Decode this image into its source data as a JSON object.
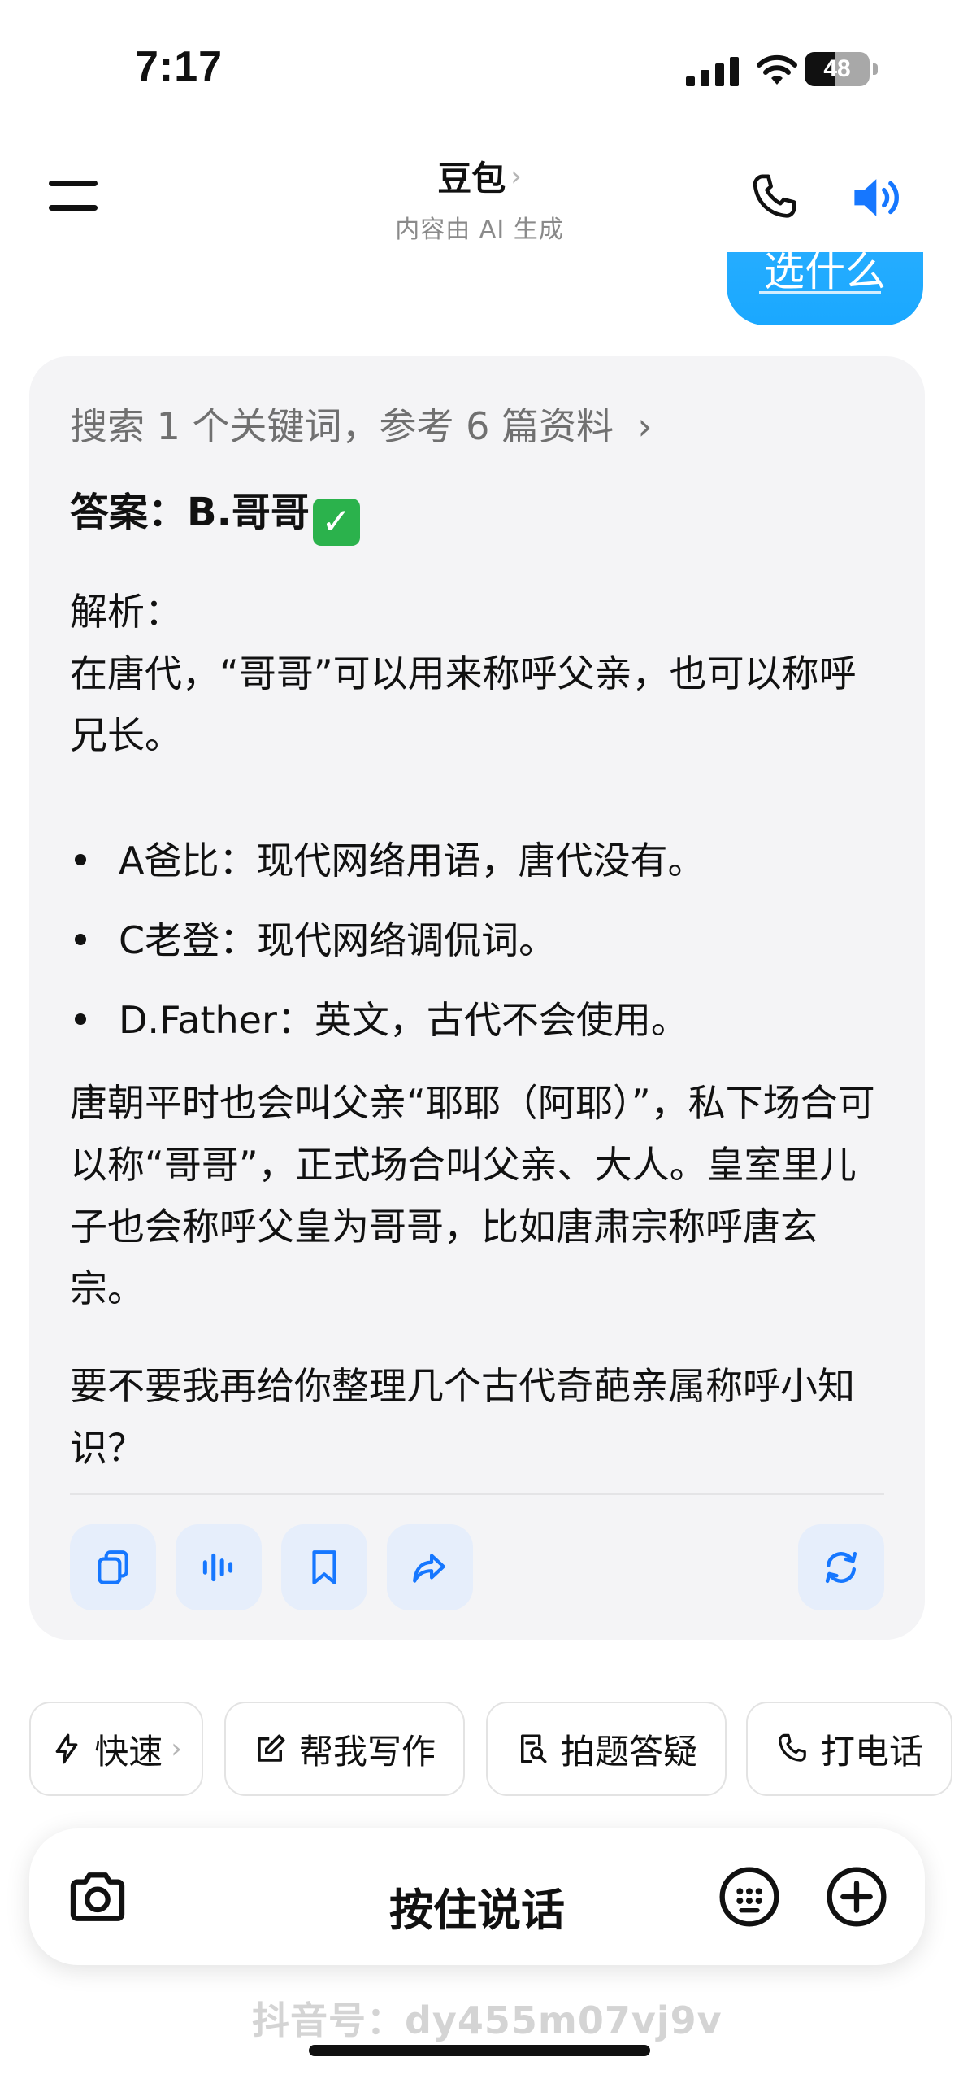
{
  "status_bar": {
    "time": "7:17",
    "battery": "48"
  },
  "header": {
    "title": "豆包",
    "subtitle": "内容由 AI 生成"
  },
  "user_message": {
    "text": "选什么"
  },
  "answer_card": {
    "search_ref": "搜索 1 个关键词，参考 6 篇资料",
    "answer_label": "答案：B.哥哥",
    "analysis_title": "解析：",
    "analysis_text": "在唐代，“哥哥”可以用来称呼父亲，也可以称呼兄长。",
    "bullets": [
      "A爸比：现代网络用语，唐代没有。",
      "C老登：现代网络调侃词。",
      "D.Father：英文，古代不会使用。"
    ],
    "paragraph": "唐朝平时也会叫父亲“耶耶（阿耶）”，私下场合可以称“哥哥”，正式场合叫父亲、大人。皇室里儿子也会称呼父皇为哥哥，比如唐肃宗称呼唐玄宗。",
    "followup": "要不要我再给你整理几个古代奇葩亲属称呼小知识？"
  },
  "quick_actions": [
    {
      "label": "快速",
      "icon": "lightning-icon"
    },
    {
      "label": "帮我写作",
      "icon": "edit-icon"
    },
    {
      "label": "拍题答疑",
      "icon": "photo-question-icon"
    },
    {
      "label": "打电话",
      "icon": "phone-icon"
    }
  ],
  "input_bar": {
    "label": "按住说话"
  },
  "watermark": "抖音号：dy455m07vj9v",
  "colors": {
    "accent_blue": "#1677ff",
    "bubble_blue": "#1aa8ff",
    "card_bg": "#f4f4f6",
    "action_bg": "#e6eefb"
  }
}
